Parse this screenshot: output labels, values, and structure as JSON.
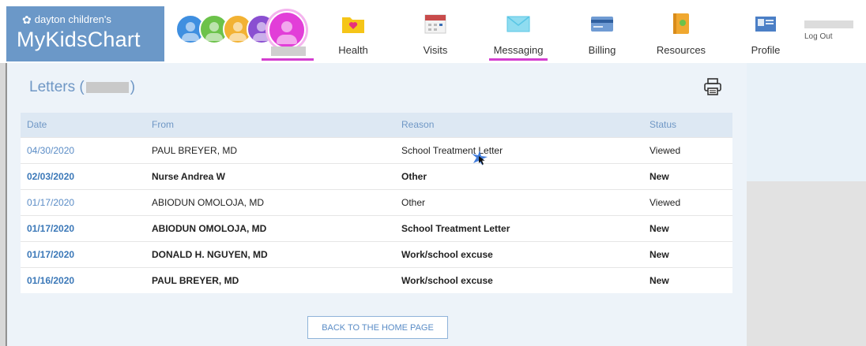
{
  "header": {
    "brand_small": "dayton children's",
    "brand_big": "MyKidsChart",
    "avatars": [
      {
        "color": "#3f8fe0"
      },
      {
        "color": "#6cc24a"
      },
      {
        "color": "#f2b233"
      },
      {
        "color": "#8a4fd1"
      },
      {
        "color": "#e23ed8"
      }
    ],
    "nav": [
      {
        "label": "Health",
        "icon": "health-folder-icon",
        "color": "#f5c518"
      },
      {
        "label": "Visits",
        "icon": "calendar-icon",
        "color": "#c84b4b"
      },
      {
        "label": "Messaging",
        "icon": "envelope-icon",
        "color": "#59c6e5",
        "active": true
      },
      {
        "label": "Billing",
        "icon": "credit-card-icon",
        "color": "#3b6fb6"
      },
      {
        "label": "Resources",
        "icon": "book-icon",
        "color": "#f0a830"
      },
      {
        "label": "Profile",
        "icon": "id-card-icon",
        "color": "#4b7fc6"
      }
    ],
    "logout": "Log Out",
    "accent": "#d43ed0"
  },
  "letters": {
    "title_prefix": "Letters (",
    "title_suffix": ")",
    "columns": [
      "Date",
      "From",
      "Reason",
      "Status"
    ],
    "rows": [
      {
        "date": "04/30/2020",
        "from": "PAUL BREYER, MD",
        "reason": "School Treatment Letter",
        "status": "Viewed"
      },
      {
        "date": "02/03/2020",
        "from": "Nurse Andrea W",
        "reason": "Other",
        "status": "New"
      },
      {
        "date": "01/17/2020",
        "from": "ABIODUN OMOLOJA, MD",
        "reason": "Other",
        "status": "Viewed"
      },
      {
        "date": "01/17/2020",
        "from": "ABIODUN OMOLOJA, MD",
        "reason": "School Treatment Letter",
        "status": "New"
      },
      {
        "date": "01/17/2020",
        "from": "DONALD H. NGUYEN, MD",
        "reason": "Work/school excuse",
        "status": "New"
      },
      {
        "date": "01/16/2020",
        "from": "PAUL BREYER, MD",
        "reason": "Work/school excuse",
        "status": "New"
      }
    ]
  },
  "back_button": "BACK TO THE HOME PAGE"
}
